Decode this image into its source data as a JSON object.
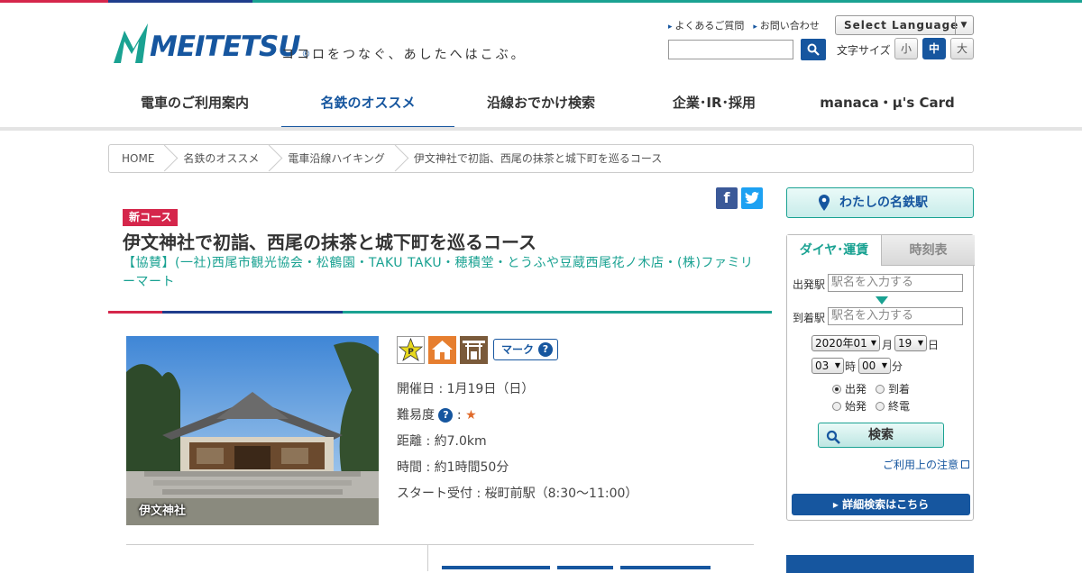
{
  "header": {
    "logo_text": "MEITETSU",
    "logo_reg": "®",
    "tagline": "ココロをつなぐ、あしたへはこぶ。",
    "util_links": [
      "よくあるご質問",
      "お問い合わせ"
    ],
    "language_select": "Select Language",
    "font_size_label": "文字サイズ",
    "font_sizes": [
      "小",
      "中",
      "大"
    ],
    "font_size_active": "中"
  },
  "gnav": {
    "items": [
      "電車のご利用案内",
      "名鉄のオススメ",
      "沿線おでかけ検索",
      "企業･IR･採用",
      "manaca・μ's Card"
    ],
    "active_index": 1
  },
  "breadcrumb": [
    "HOME",
    "名鉄のオススメ",
    "電車沿線ハイキング",
    "伊文神社で初詣、西尾の抹茶と城下町を巡るコース"
  ],
  "share": {
    "facebook": "f",
    "twitter": "t"
  },
  "article": {
    "badge": "新コース",
    "title": "伊文神社で初詣、西尾の抹茶と城下町を巡るコース",
    "sponsor": "【協賛】(一社)西尾市観光協会・松鶴園・TAKU TAKU・穂積堂・とうふや豆蔵西尾花ノ木店・(株)ファミリーマート",
    "photo_caption": "伊文神社",
    "mark_button": "マーク",
    "details": {
      "date": "開催日 : 1月19日（日）",
      "difficulty_label": "難易度",
      "difficulty_stars": "★",
      "distance": "距離 : 約7.0km",
      "time": "時間 : 約1時間50分",
      "start": "スタート受付 : 桜町前駅（8:30～11:00）"
    }
  },
  "sidebar": {
    "my_station": "わたしの名鉄駅",
    "tabs": [
      "ダイヤ･運賃",
      "時刻表"
    ],
    "from_label": "出発駅",
    "to_label": "到着駅",
    "station_placeholder": "駅名を入力する",
    "year_month": "2020年01",
    "month_unit": "月",
    "day": "19",
    "day_unit": "日",
    "hour": "03",
    "hour_unit": "時",
    "minute": "00",
    "minute_unit": "分",
    "radios": [
      "出発",
      "到着",
      "始発",
      "終電"
    ],
    "radio_selected": "出発",
    "search_button": "検索",
    "note_link": "ご利用上の注意",
    "detail_search": "▸ 詳細検索はこちら"
  },
  "colors": {
    "brand_blue": "#16569f",
    "brand_teal": "#1aa292",
    "brand_red": "#d5264b"
  }
}
